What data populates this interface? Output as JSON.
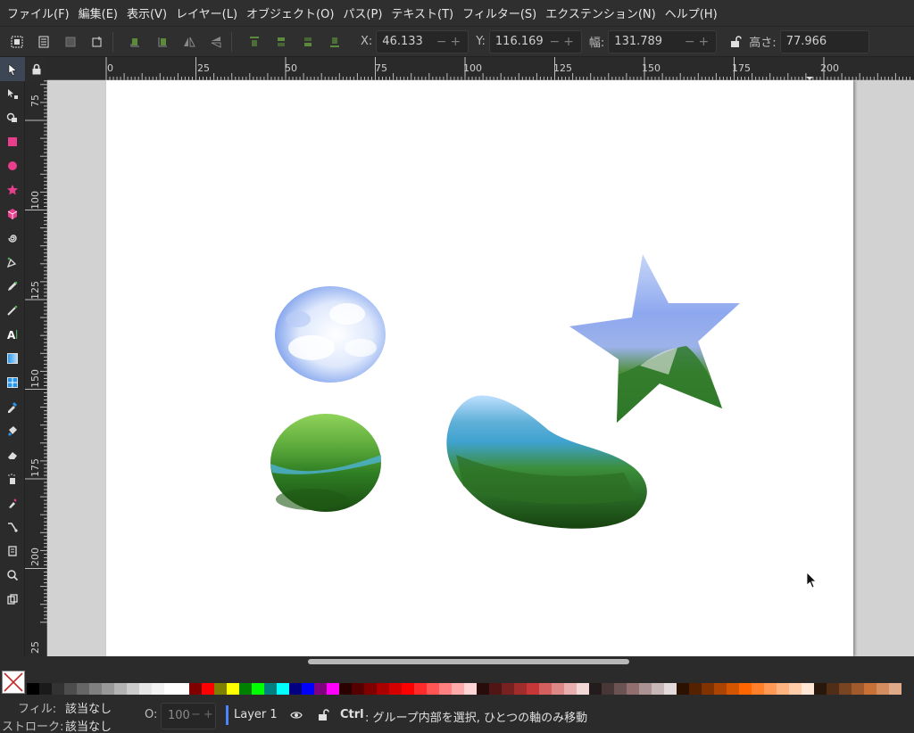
{
  "menu": {
    "items": [
      "ファイル(F)",
      "編集(E)",
      "表示(V)",
      "レイヤー(L)",
      "オブジェクト(O)",
      "パス(P)",
      "テキスト(T)",
      "フィルター(S)",
      "エクステンション(N)",
      "ヘルプ(H)"
    ]
  },
  "toolctrl": {
    "x_label": "X:",
    "x_value": "46.133",
    "y_label": "Y:",
    "y_value": "116.169",
    "w_label": "幅:",
    "w_value": "131.789",
    "h_label": "高さ:",
    "h_value": "77.966",
    "spin_glyph": "−+"
  },
  "ruler": {
    "h_ticks": [
      "0",
      "25",
      "50",
      "75",
      "100",
      "125",
      "150",
      "175",
      "200"
    ],
    "v_ticks": [
      "75",
      "100",
      "125",
      "150",
      "175",
      "200",
      "25"
    ]
  },
  "palette": {
    "colors": [
      "#000000",
      "#1a1a1a",
      "#333333",
      "#4d4d4d",
      "#666666",
      "#808080",
      "#999999",
      "#b3b3b3",
      "#cccccc",
      "#e6e6e6",
      "#f2f2f2",
      "#ffffff",
      "#ffffff",
      "#800000",
      "#ff0000",
      "#808000",
      "#ffff00",
      "#008000",
      "#00ff00",
      "#008080",
      "#00ffff",
      "#000080",
      "#0000ff",
      "#800080",
      "#ff00ff",
      "#2b0000",
      "#550000",
      "#800000",
      "#aa0000",
      "#d40000",
      "#ff0000",
      "#ff2a2a",
      "#ff5555",
      "#ff8080",
      "#ffaaaa",
      "#ffd5d5",
      "#280b0b",
      "#501616",
      "#782121",
      "#a02c2c",
      "#c83737",
      "#d35f5f",
      "#de8787",
      "#e9afaf",
      "#f4d7d7",
      "#241c1c",
      "#483737",
      "#6c5353",
      "#916f6f",
      "#ac9393",
      "#c8b7b7",
      "#e3dbdb",
      "#2b1100",
      "#552200",
      "#803300",
      "#aa4400",
      "#d45500",
      "#ff6600",
      "#ff7f2a",
      "#ff9955",
      "#ffb380",
      "#ffccaa",
      "#ffe6d5",
      "#28170b",
      "#502d16",
      "#784421",
      "#a05a2c",
      "#c87137",
      "#d38d5f",
      "#deaa87"
    ]
  },
  "status": {
    "fill_label": "フィル:",
    "fill_value": "該当なし",
    "stroke_label": "ストローク:",
    "stroke_value": "該当なし",
    "opacity_label": "O:",
    "opacity_value": "100",
    "layer_name": "Layer 1",
    "hint_key": "Ctrl",
    "hint_text": ": グループ内部を選択, ひとつの軸のみ移動"
  }
}
